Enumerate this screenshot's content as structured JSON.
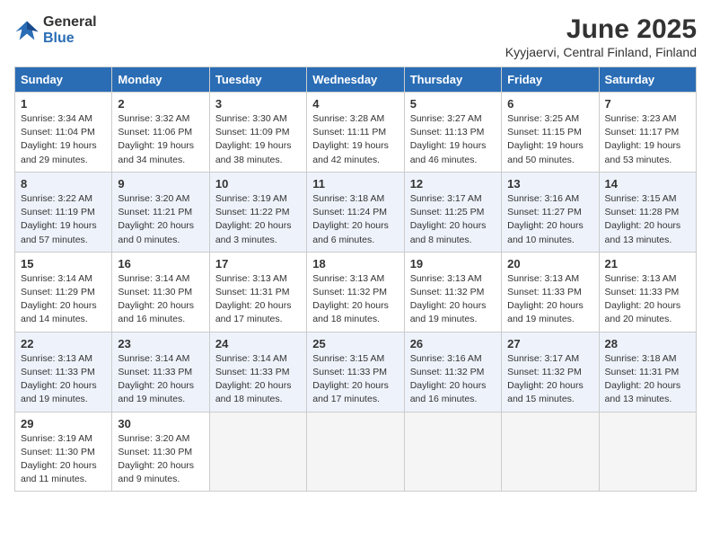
{
  "logo": {
    "general": "General",
    "blue": "Blue"
  },
  "title": "June 2025",
  "subtitle": "Kyyjaervi, Central Finland, Finland",
  "headers": [
    "Sunday",
    "Monday",
    "Tuesday",
    "Wednesday",
    "Thursday",
    "Friday",
    "Saturday"
  ],
  "weeks": [
    [
      {
        "day": "1",
        "info": "Sunrise: 3:34 AM\nSunset: 11:04 PM\nDaylight: 19 hours\nand 29 minutes."
      },
      {
        "day": "2",
        "info": "Sunrise: 3:32 AM\nSunset: 11:06 PM\nDaylight: 19 hours\nand 34 minutes."
      },
      {
        "day": "3",
        "info": "Sunrise: 3:30 AM\nSunset: 11:09 PM\nDaylight: 19 hours\nand 38 minutes."
      },
      {
        "day": "4",
        "info": "Sunrise: 3:28 AM\nSunset: 11:11 PM\nDaylight: 19 hours\nand 42 minutes."
      },
      {
        "day": "5",
        "info": "Sunrise: 3:27 AM\nSunset: 11:13 PM\nDaylight: 19 hours\nand 46 minutes."
      },
      {
        "day": "6",
        "info": "Sunrise: 3:25 AM\nSunset: 11:15 PM\nDaylight: 19 hours\nand 50 minutes."
      },
      {
        "day": "7",
        "info": "Sunrise: 3:23 AM\nSunset: 11:17 PM\nDaylight: 19 hours\nand 53 minutes."
      }
    ],
    [
      {
        "day": "8",
        "info": "Sunrise: 3:22 AM\nSunset: 11:19 PM\nDaylight: 19 hours\nand 57 minutes."
      },
      {
        "day": "9",
        "info": "Sunrise: 3:20 AM\nSunset: 11:21 PM\nDaylight: 20 hours\nand 0 minutes."
      },
      {
        "day": "10",
        "info": "Sunrise: 3:19 AM\nSunset: 11:22 PM\nDaylight: 20 hours\nand 3 minutes."
      },
      {
        "day": "11",
        "info": "Sunrise: 3:18 AM\nSunset: 11:24 PM\nDaylight: 20 hours\nand 6 minutes."
      },
      {
        "day": "12",
        "info": "Sunrise: 3:17 AM\nSunset: 11:25 PM\nDaylight: 20 hours\nand 8 minutes."
      },
      {
        "day": "13",
        "info": "Sunrise: 3:16 AM\nSunset: 11:27 PM\nDaylight: 20 hours\nand 10 minutes."
      },
      {
        "day": "14",
        "info": "Sunrise: 3:15 AM\nSunset: 11:28 PM\nDaylight: 20 hours\nand 13 minutes."
      }
    ],
    [
      {
        "day": "15",
        "info": "Sunrise: 3:14 AM\nSunset: 11:29 PM\nDaylight: 20 hours\nand 14 minutes."
      },
      {
        "day": "16",
        "info": "Sunrise: 3:14 AM\nSunset: 11:30 PM\nDaylight: 20 hours\nand 16 minutes."
      },
      {
        "day": "17",
        "info": "Sunrise: 3:13 AM\nSunset: 11:31 PM\nDaylight: 20 hours\nand 17 minutes."
      },
      {
        "day": "18",
        "info": "Sunrise: 3:13 AM\nSunset: 11:32 PM\nDaylight: 20 hours\nand 18 minutes."
      },
      {
        "day": "19",
        "info": "Sunrise: 3:13 AM\nSunset: 11:32 PM\nDaylight: 20 hours\nand 19 minutes."
      },
      {
        "day": "20",
        "info": "Sunrise: 3:13 AM\nSunset: 11:33 PM\nDaylight: 20 hours\nand 19 minutes."
      },
      {
        "day": "21",
        "info": "Sunrise: 3:13 AM\nSunset: 11:33 PM\nDaylight: 20 hours\nand 20 minutes."
      }
    ],
    [
      {
        "day": "22",
        "info": "Sunrise: 3:13 AM\nSunset: 11:33 PM\nDaylight: 20 hours\nand 19 minutes."
      },
      {
        "day": "23",
        "info": "Sunrise: 3:14 AM\nSunset: 11:33 PM\nDaylight: 20 hours\nand 19 minutes."
      },
      {
        "day": "24",
        "info": "Sunrise: 3:14 AM\nSunset: 11:33 PM\nDaylight: 20 hours\nand 18 minutes."
      },
      {
        "day": "25",
        "info": "Sunrise: 3:15 AM\nSunset: 11:33 PM\nDaylight: 20 hours\nand 17 minutes."
      },
      {
        "day": "26",
        "info": "Sunrise: 3:16 AM\nSunset: 11:32 PM\nDaylight: 20 hours\nand 16 minutes."
      },
      {
        "day": "27",
        "info": "Sunrise: 3:17 AM\nSunset: 11:32 PM\nDaylight: 20 hours\nand 15 minutes."
      },
      {
        "day": "28",
        "info": "Sunrise: 3:18 AM\nSunset: 11:31 PM\nDaylight: 20 hours\nand 13 minutes."
      }
    ],
    [
      {
        "day": "29",
        "info": "Sunrise: 3:19 AM\nSunset: 11:30 PM\nDaylight: 20 hours\nand 11 minutes."
      },
      {
        "day": "30",
        "info": "Sunrise: 3:20 AM\nSunset: 11:30 PM\nDaylight: 20 hours\nand 9 minutes."
      },
      {
        "day": "",
        "info": ""
      },
      {
        "day": "",
        "info": ""
      },
      {
        "day": "",
        "info": ""
      },
      {
        "day": "",
        "info": ""
      },
      {
        "day": "",
        "info": ""
      }
    ]
  ]
}
